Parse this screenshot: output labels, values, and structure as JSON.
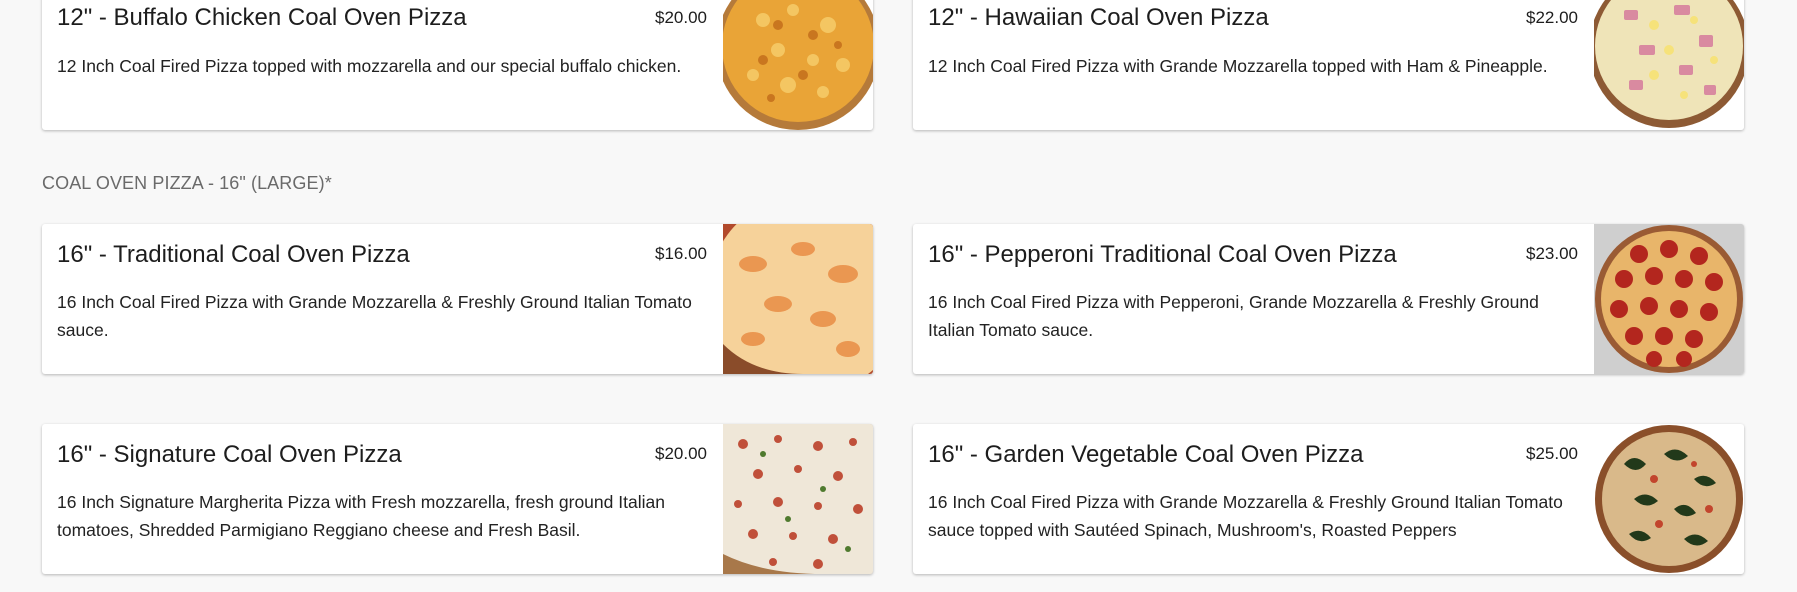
{
  "sections": [
    {
      "heading": "",
      "items": [
        {
          "name": "12\" - Buffalo Chicken Coal Oven Pizza",
          "price": "$20.00",
          "description": "12 Inch Coal Fired Pizza topped with mozzarella and our special buffalo chicken."
        },
        {
          "name": "12\" - Hawaiian Coal Oven Pizza",
          "price": "$22.00",
          "description": "12 Inch Coal Fired Pizza with Grande Mozzarella topped with Ham & Pineapple."
        }
      ]
    },
    {
      "heading": "COAL OVEN PIZZA - 16\" (LARGE)*",
      "items": [
        {
          "name": "16\" - Traditional Coal Oven Pizza",
          "price": "$16.00",
          "description": "16 Inch Coal Fired Pizza with Grande Mozzarella & Freshly Ground Italian Tomato sauce."
        },
        {
          "name": "16\" - Pepperoni Traditional Coal Oven Pizza",
          "price": "$23.00",
          "description": "16 Inch Coal Fired Pizza with Pepperoni, Grande Mozzarella & Freshly Ground Italian Tomato sauce."
        },
        {
          "name": "16\" - Signature Coal Oven Pizza",
          "price": "$20.00",
          "description": "16 Inch Signature Margherita Pizza with Fresh mozzarella, fresh ground Italian tomatoes, Shredded Parmigiano Reggiano cheese and Fresh Basil."
        },
        {
          "name": "16\" - Garden Vegetable Coal Oven Pizza",
          "price": "$25.00",
          "description": "16 Inch Coal Fired Pizza with Grande Mozzarella & Freshly Ground Italian Tomato sauce topped with Sautéed Spinach, Mushroom's, Roasted Peppers"
        }
      ]
    }
  ],
  "images": {
    "buffalo": "buffalo-chicken-pizza-photo",
    "hawaiian": "hawaiian-pizza-photo",
    "traditional": "traditional-pizza-photo",
    "pepperoni": "pepperoni-pizza-photo",
    "signature": "signature-pizza-photo",
    "garden": "garden-vegetable-pizza-photo"
  },
  "colors": {
    "background": "#f8f8f8",
    "card": "#ffffff",
    "heading": "#6a6a6a"
  }
}
